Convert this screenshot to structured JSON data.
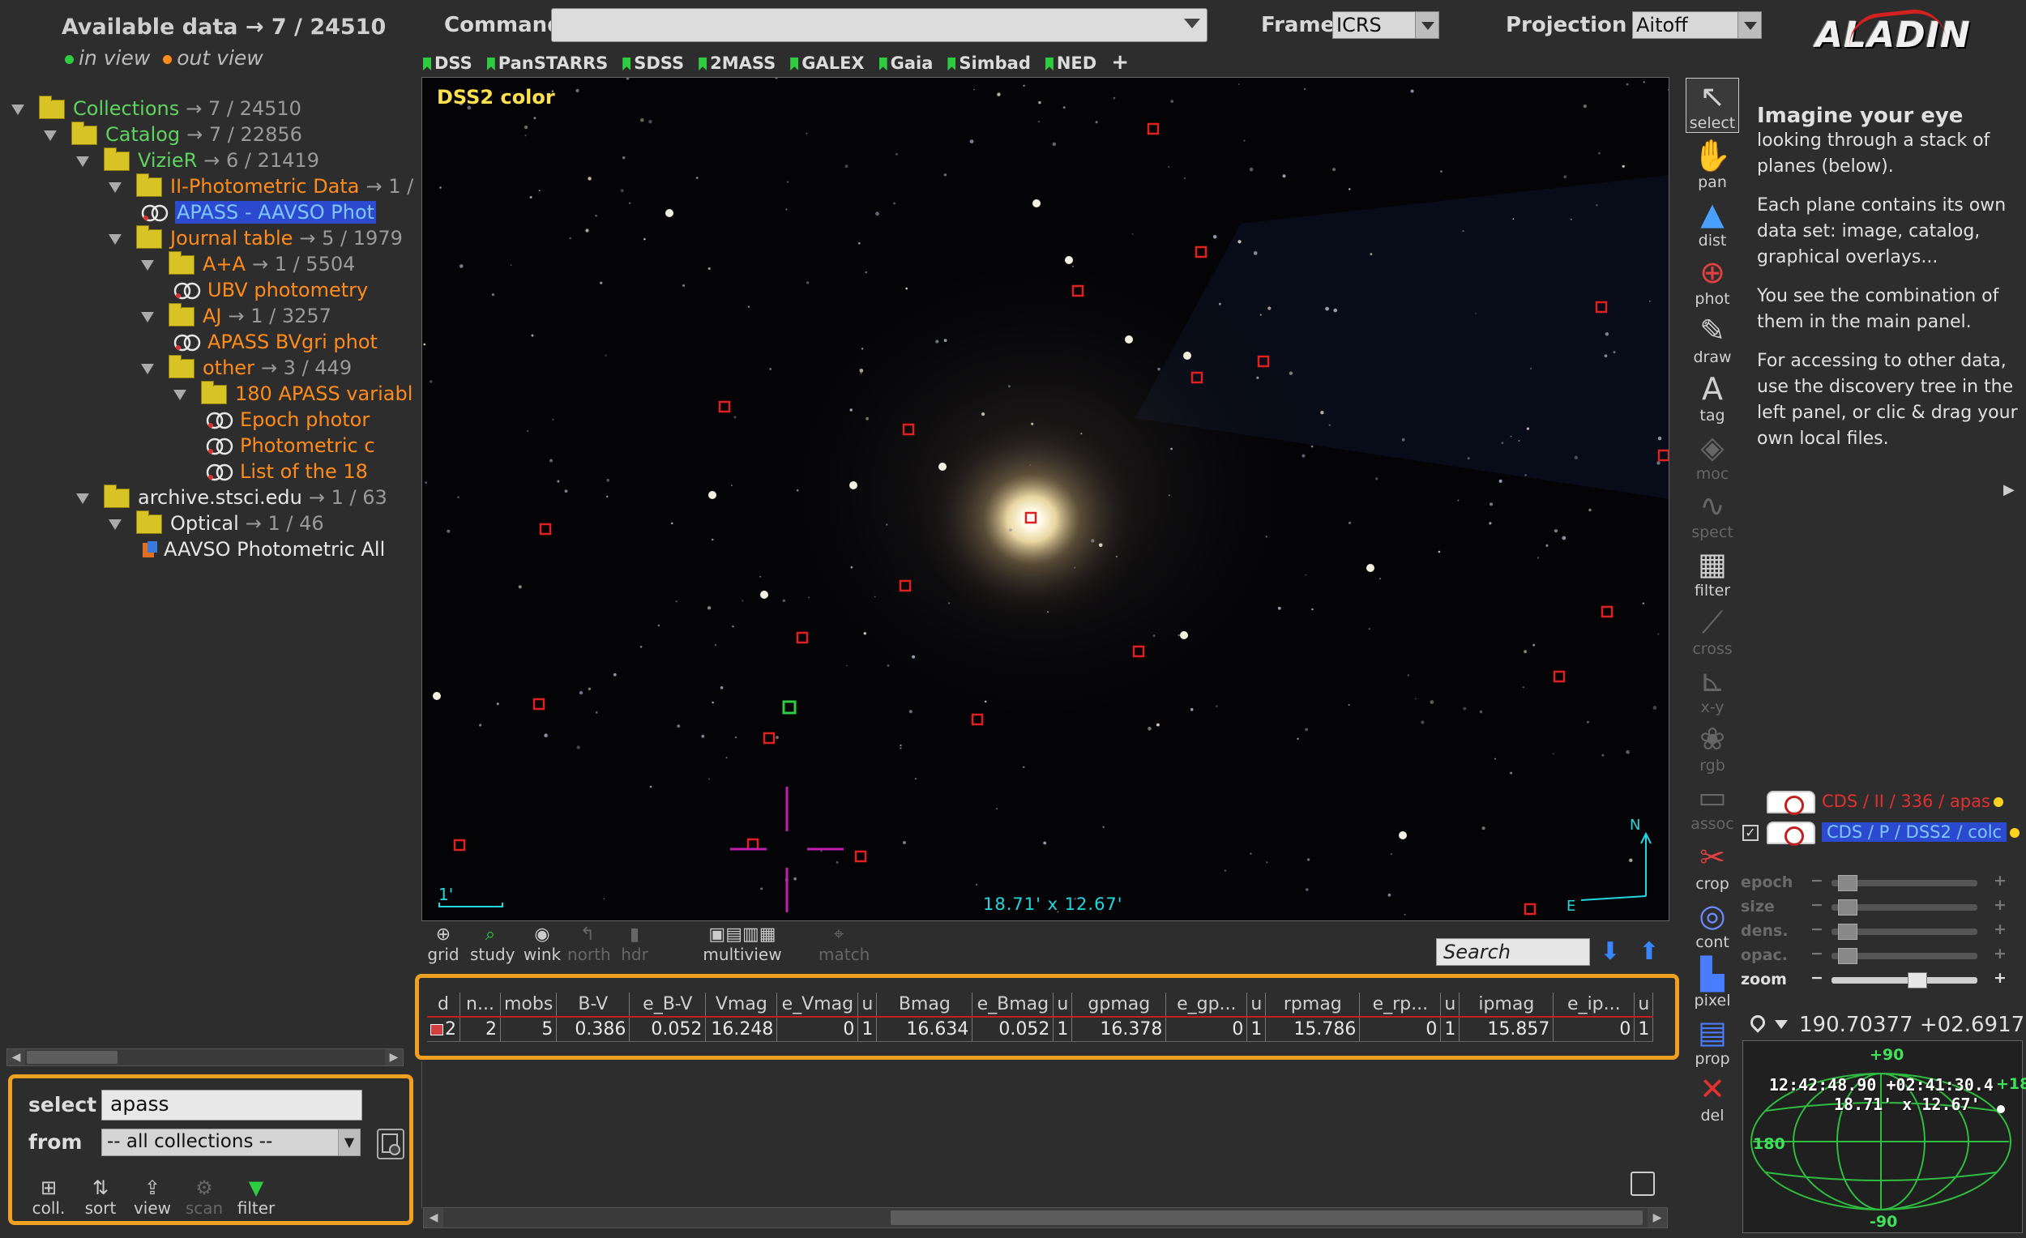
{
  "header": {
    "available_title": "Available data → 7 / 24510",
    "in_view": "in view",
    "out_view": "out view",
    "in_view_color": "#2ecc40",
    "out_view_color": "#ff8c1a"
  },
  "tree": [
    {
      "label": "Collections",
      "count": "→ 7 / 24510",
      "color": "green",
      "icon": "folder-icon"
    },
    {
      "label": "Catalog",
      "count": "→ 7 / 22856",
      "color": "green",
      "icon": "folder-icon"
    },
    {
      "label": "VizieR",
      "count": "→ 6 / 21419",
      "color": "green",
      "icon": "folder-icon"
    },
    {
      "label": "II-Photometric Data",
      "count": "→ 1 /",
      "color": "orange",
      "icon": "folder-icon"
    },
    {
      "label": "APASS - AAVSO Phot",
      "count": "",
      "color": "highlight",
      "icon": "catalog-icon"
    },
    {
      "label": "Journal table",
      "count": "→ 5 / 1979",
      "color": "orange",
      "icon": "folder-icon"
    },
    {
      "label": "A+A",
      "count": "→ 1 / 5504",
      "color": "orange",
      "icon": "folder-icon"
    },
    {
      "label": "UBV photometry",
      "count": "",
      "color": "orange",
      "icon": "catalog-icon"
    },
    {
      "label": "AJ",
      "count": "→ 1 / 3257",
      "color": "orange",
      "icon": "folder-icon"
    },
    {
      "label": "APASS BVgri phot",
      "count": "",
      "color": "orange",
      "icon": "catalog-icon"
    },
    {
      "label": "other",
      "count": "→ 3 / 449",
      "color": "orange",
      "icon": "folder-icon"
    },
    {
      "label": "180 APASS variabl",
      "count": "",
      "color": "orange",
      "icon": "folder-icon"
    },
    {
      "label": "Epoch photor",
      "count": "",
      "color": "orange",
      "icon": "catalog-icon"
    },
    {
      "label": "Photometric c",
      "count": "",
      "color": "orange",
      "icon": "catalog-icon"
    },
    {
      "label": "List of the 18",
      "count": "",
      "color": "orange",
      "icon": "catalog-icon"
    },
    {
      "label": "archive.stsci.edu",
      "count": "→ 1 / 63",
      "color": "white",
      "icon": "folder-icon"
    },
    {
      "label": "Optical",
      "count": "→ 1 / 46",
      "color": "white",
      "icon": "folder-icon"
    },
    {
      "label": "AAVSO Photometric All",
      "count": "",
      "color": "white",
      "icon": "image-icon"
    }
  ],
  "selector": {
    "select_label": "select",
    "select_value": "apass",
    "from_label": "from",
    "from_value": "-- all collections --",
    "tools": [
      {
        "label": "coll.",
        "icon": "collection-icon",
        "dim": false
      },
      {
        "label": "sort",
        "icon": "sort-icon",
        "dim": false
      },
      {
        "label": "view",
        "icon": "view-icon",
        "dim": false
      },
      {
        "label": "scan",
        "icon": "scan-icon",
        "dim": true
      },
      {
        "label": "filter",
        "icon": "filter-icon",
        "dim": false
      }
    ]
  },
  "topbar": {
    "command_label": "Command",
    "command_value": "",
    "frame_label": "Frame",
    "frame_value": "ICRS",
    "projection_label": "Projection",
    "projection_value": "Aitoff",
    "logo": "ALADIN"
  },
  "surveys": [
    "DSS",
    "PanSTARRS",
    "SDSS",
    "2MASS",
    "GALEX",
    "Gaia",
    "Simbad",
    "NED"
  ],
  "surveys_plus": "+",
  "view": {
    "title": "DSS2 color",
    "fov": "18.71' x 12.67'",
    "scale": "1'",
    "north": "N",
    "east": "E"
  },
  "view_tools": [
    {
      "label": "grid",
      "icon": "grid-icon",
      "dim": false
    },
    {
      "label": "study",
      "icon": "study-icon",
      "dim": false
    },
    {
      "label": "wink",
      "icon": "wink-icon",
      "dim": false
    },
    {
      "label": "north",
      "icon": "north-icon",
      "dim": true
    },
    {
      "label": "hdr",
      "icon": "hdr-icon",
      "dim": true
    },
    {
      "label": "multiview",
      "icon": "multiview-icon",
      "dim": false
    },
    {
      "label": "match",
      "icon": "match-icon",
      "dim": true
    }
  ],
  "search_placeholder": "Search",
  "table": {
    "headers": [
      "d",
      "n...",
      "mobs",
      "B-V",
      "e_B-V",
      "Vmag",
      "e_Vmag",
      "u",
      "Bmag",
      "e_Bmag",
      "u",
      "gpmag",
      "e_gp...",
      "u",
      "rpmag",
      "e_rp...",
      "u",
      "ipmag",
      "e_ip...",
      "u"
    ],
    "row": [
      "2",
      "2",
      "5",
      "0.386",
      "0.052",
      "16.248",
      "0",
      "1",
      "16.634",
      "0.052",
      "1",
      "16.378",
      "0",
      "1",
      "15.786",
      "0",
      "1",
      "15.857",
      "0",
      "1"
    ]
  },
  "right_tools": [
    {
      "label": "select",
      "icon": "cursor-icon",
      "dim": false,
      "selected": true
    },
    {
      "label": "pan",
      "icon": "hand-icon",
      "dim": false
    },
    {
      "label": "dist",
      "icon": "dist-icon",
      "dim": false
    },
    {
      "label": "phot",
      "icon": "phot-icon",
      "dim": false
    },
    {
      "label": "draw",
      "icon": "pencil-icon",
      "dim": false
    },
    {
      "label": "tag",
      "icon": "tag-icon",
      "dim": false
    },
    {
      "label": "moc",
      "icon": "moc-icon",
      "dim": true
    },
    {
      "label": "spect",
      "icon": "spect-icon",
      "dim": true
    },
    {
      "label": "filter",
      "icon": "filter-icon",
      "dim": false
    },
    {
      "label": "cross",
      "icon": "cross-icon",
      "dim": true
    },
    {
      "label": "x-y",
      "icon": "xy-icon",
      "dim": true
    },
    {
      "label": "rgb",
      "icon": "rgb-icon",
      "dim": true
    },
    {
      "label": "assoc",
      "icon": "assoc-icon",
      "dim": true
    },
    {
      "label": "crop",
      "icon": "scissors-icon",
      "dim": false
    },
    {
      "label": "cont",
      "icon": "contour-icon",
      "dim": false
    },
    {
      "label": "pixel",
      "icon": "pixel-icon",
      "dim": false
    },
    {
      "label": "prop",
      "icon": "prop-icon",
      "dim": false
    },
    {
      "label": "del",
      "icon": "delete-icon",
      "dim": false
    }
  ],
  "info": {
    "title": "Imagine your eye",
    "p1": "looking through a stack of planes (below).",
    "p2": "Each plane contains its own data set: image, catalog, graphical overlays...",
    "p3": "You see the combination of them in the main panel.",
    "p4": "For accessing to other data, use the discovery tree in the left panel, or clic & drag your own local files."
  },
  "planes": [
    {
      "label": "CDS / II / 336 / apas"
    },
    {
      "label": "CDS / P / DSS2 / colc"
    }
  ],
  "sliders": [
    {
      "label": "epoch",
      "level": 0.05,
      "on": false
    },
    {
      "label": "size",
      "level": 0.05,
      "on": false
    },
    {
      "label": "dens.",
      "level": 0.05,
      "on": false
    },
    {
      "label": "opac.",
      "level": 0.05,
      "on": false
    },
    {
      "label": "zoom",
      "level": 0.6,
      "on": true
    }
  ],
  "position": {
    "coords": "190.70377 +02.6917",
    "center": "12:42:48.90 +02:41:30.4",
    "fov": "18.71' x 12.67'",
    "lat_top": "+90",
    "lat_bottom": "-90",
    "lon_left": "180",
    "lon_right": "+18"
  },
  "colors": {
    "background": "#2d2d2d",
    "highlight_yellow": "#f0a020",
    "marker_red": "#e02020",
    "overlay_cyan": "#22d8e0"
  }
}
